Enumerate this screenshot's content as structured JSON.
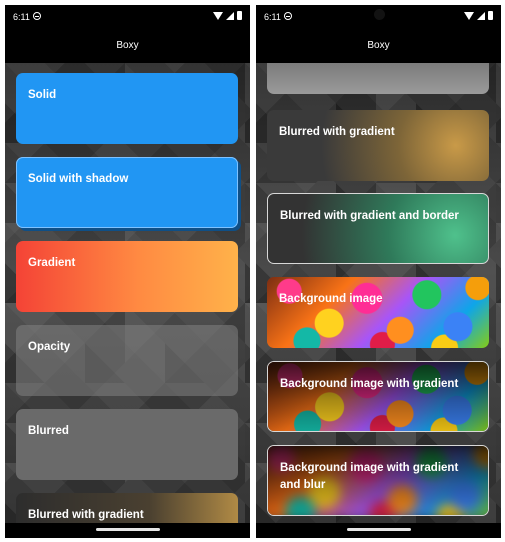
{
  "status": {
    "time": "6:11"
  },
  "app": {
    "title": "Boxy"
  },
  "left": {
    "cards": {
      "solid": "Solid",
      "solid_shadow": "Solid with shadow",
      "gradient": "Gradient",
      "opacity": "Opacity",
      "blurred": "Blurred",
      "blurred_gradient": "Blurred with gradient"
    }
  },
  "right": {
    "cards": {
      "blurred_gradient": "Blurred with gradient",
      "blurred_gradient_border": "Blurred with gradient and border",
      "background_image": "Background image",
      "background_image_gradient": "Background image with gradient",
      "background_image_gradient_blur": "Background image with gradient and blur"
    }
  },
  "icons": [
    "do-not-disturb-icon",
    "wifi-icon",
    "signal-icon",
    "battery-icon"
  ],
  "colors": {
    "solid": "#2196f3",
    "gradient_start": "#f44336",
    "gradient_end": "#ffb24a"
  }
}
